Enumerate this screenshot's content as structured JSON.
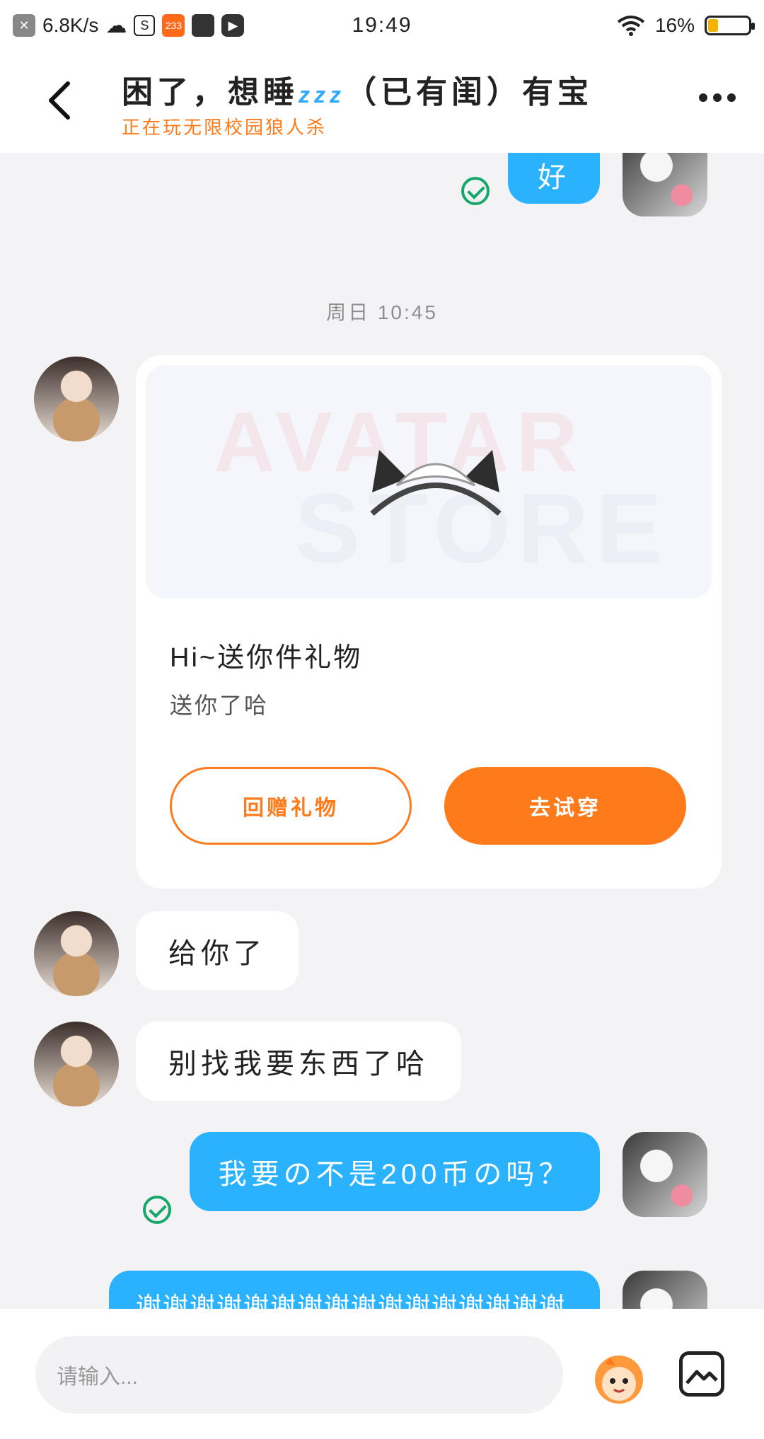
{
  "status_bar": {
    "speed": "6.8K/s",
    "badge_233": "233",
    "time": "19:49",
    "battery": "16%",
    "battery_level": 0.16
  },
  "header": {
    "title_part1": "困了，想睡",
    "title_zzz": "zzz",
    "title_part2": "（已有闺）有宝",
    "subtitle": "正在玩无限校园狼人杀"
  },
  "messages": {
    "top_me": "好",
    "timestamp": "周日 10:45",
    "gift_card": {
      "watermark_line1": "AVATAR",
      "watermark_line2": "STORE",
      "title": "Hi~送你件礼物",
      "subtitle": "送你了哈",
      "button_return": "回赠礼物",
      "button_try": "去试穿"
    },
    "them_1": "给你了",
    "them_2": "别找我要东西了哈",
    "me_2": "我要の不是200币の吗？",
    "me_3_partial": "谢谢谢谢谢谢谢谢谢谢谢谢谢谢谢谢"
  },
  "input_bar": {
    "placeholder": "请输入..."
  },
  "colors": {
    "accent_orange": "#ff7a1a",
    "bubble_blue": "#2ab2ff",
    "check_green": "#16a86b"
  }
}
